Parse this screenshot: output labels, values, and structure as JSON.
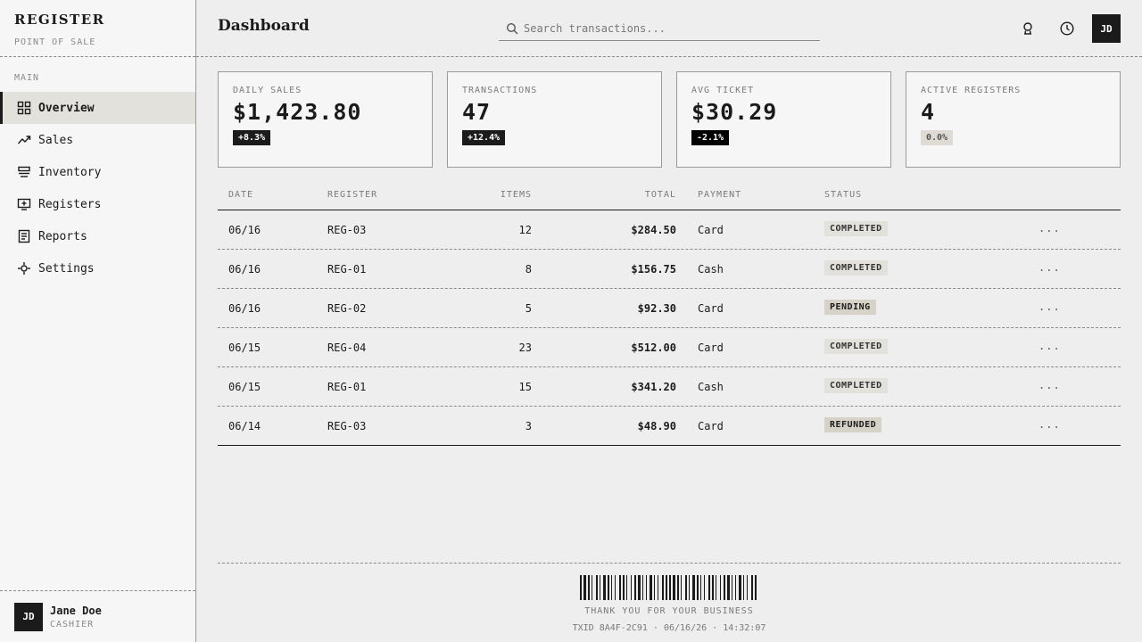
{
  "brand": {
    "title": "REGISTER",
    "subtitle": "POINT OF SALE"
  },
  "nav": {
    "section": "MAIN",
    "items": [
      {
        "label": "Overview",
        "icon": "grid-icon",
        "active": true
      },
      {
        "label": "Sales",
        "icon": "trend-icon"
      },
      {
        "label": "Inventory",
        "icon": "stack-icon"
      },
      {
        "label": "Registers",
        "icon": "monitor-icon"
      },
      {
        "label": "Reports",
        "icon": "document-icon"
      },
      {
        "label": "Settings",
        "icon": "gear-icon"
      }
    ]
  },
  "user": {
    "initials": "JD",
    "name": "Jane Doe",
    "role": "CASHIER"
  },
  "header": {
    "title": "Dashboard",
    "search_placeholder": "Search transactions...",
    "avatar": "JD"
  },
  "stats": [
    {
      "label": "DAILY SALES",
      "value": "$1,423.80",
      "change": "+8.3%"
    },
    {
      "label": "TRANSACTIONS",
      "value": "47",
      "change": "+12.4%"
    },
    {
      "label": "AVG TICKET",
      "value": "$30.29",
      "change": "-2.1%"
    },
    {
      "label": "ACTIVE REGISTERS",
      "value": "4",
      "change": "0.0%"
    }
  ],
  "table": {
    "headers": {
      "date": "DATE",
      "register": "REGISTER",
      "items": "ITEMS",
      "total": "TOTAL",
      "payment": "PAYMENT",
      "status": "STATUS"
    },
    "rows": [
      {
        "date": "06/16",
        "register": "REG-03",
        "items": "12",
        "total": "$284.50",
        "payment": "Card",
        "status": "COMPLETED",
        "more": "..."
      },
      {
        "date": "06/16",
        "register": "REG-01",
        "items": "8",
        "total": "$156.75",
        "payment": "Cash",
        "status": "COMPLETED",
        "more": "..."
      },
      {
        "date": "06/16",
        "register": "REG-02",
        "items": "5",
        "total": "$92.30",
        "payment": "Card",
        "status": "PENDING",
        "more": "..."
      },
      {
        "date": "06/15",
        "register": "REG-04",
        "items": "23",
        "total": "$512.00",
        "payment": "Card",
        "status": "COMPLETED",
        "more": "..."
      },
      {
        "date": "06/15",
        "register": "REG-01",
        "items": "15",
        "total": "$341.20",
        "payment": "Cash",
        "status": "COMPLETED",
        "more": "..."
      },
      {
        "date": "06/14",
        "register": "REG-03",
        "items": "3",
        "total": "$48.90",
        "payment": "Card",
        "status": "REFUNDED",
        "more": "..."
      }
    ]
  },
  "footer": {
    "thanks": "THANK YOU FOR YOUR BUSINESS",
    "txid": "TXID 8A4F-2C91 · 06/16/26 · 14:32:07"
  },
  "colors": {
    "ink": "#1b1b1b",
    "muted": "#8a8a8a",
    "panel": "#f6f6f6",
    "accent_bg": "#e3e1dc"
  }
}
